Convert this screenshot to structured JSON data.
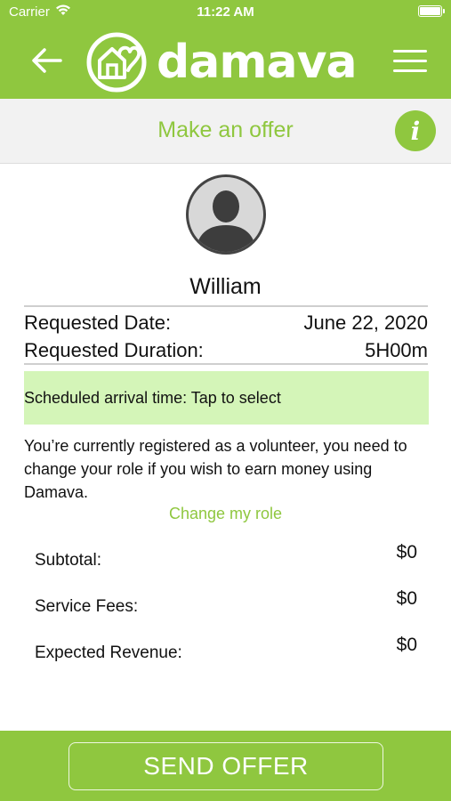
{
  "status_bar": {
    "carrier": "Carrier",
    "time": "11:22 AM"
  },
  "header": {
    "logo_text": "damava",
    "brand_color": "#8fc73f"
  },
  "subheader": {
    "title": "Make an offer",
    "info_label": "i"
  },
  "profile": {
    "name": "William"
  },
  "request": {
    "date_label": "Requested Date:",
    "date_value": "June 22, 2020",
    "duration_label": "Requested Duration:",
    "duration_value": "5H00m"
  },
  "arrival": {
    "label": "Scheduled arrival time: Tap to select",
    "highlight_color": "#d4f5b8"
  },
  "notice": {
    "text": "You’re currently registered as a volunteer, you need to change your role if you wish to earn money using Damava.",
    "change_role_link": "Change my role"
  },
  "summary": [
    {
      "label": "Subtotal:",
      "value": "$0"
    },
    {
      "label": "Service Fees:",
      "value": "$0"
    },
    {
      "label": "Expected Revenue:",
      "value": "$0"
    }
  ],
  "footer": {
    "send_label": "SEND OFFER"
  },
  "icons": [
    "wifi-icon",
    "battery-icon",
    "back-arrow-icon",
    "logo-house-heart-icon",
    "menu-icon",
    "info-icon",
    "avatar-silhouette-icon"
  ]
}
